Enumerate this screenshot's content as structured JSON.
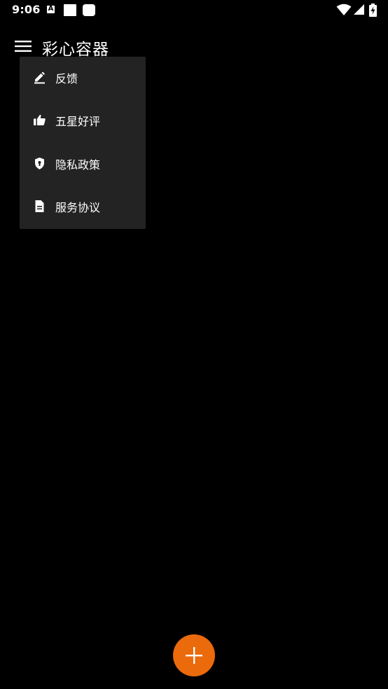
{
  "status_bar": {
    "time": "9:06",
    "notification_icons": [
      "a-icon",
      "square-icon",
      "rounded-square-icon"
    ],
    "right_icons": [
      "wifi-icon",
      "signal-icon",
      "battery-charging-icon"
    ],
    "notif_a_letter": "A"
  },
  "app_bar": {
    "title": "彩心容器",
    "menu_icon": "menu-icon"
  },
  "popup_menu": {
    "items": [
      {
        "label": "反馈",
        "icon": "edit-icon"
      },
      {
        "label": "五星好评",
        "icon": "thumb-up-icon"
      },
      {
        "label": "隐私政策",
        "icon": "shield-icon"
      },
      {
        "label": "服务协议",
        "icon": "document-icon"
      }
    ]
  },
  "fab": {
    "icon": "plus-icon",
    "color": "#ea6a0c"
  },
  "colors": {
    "background": "#000000",
    "menu_background": "#232323",
    "accent": "#ea6a0c"
  }
}
